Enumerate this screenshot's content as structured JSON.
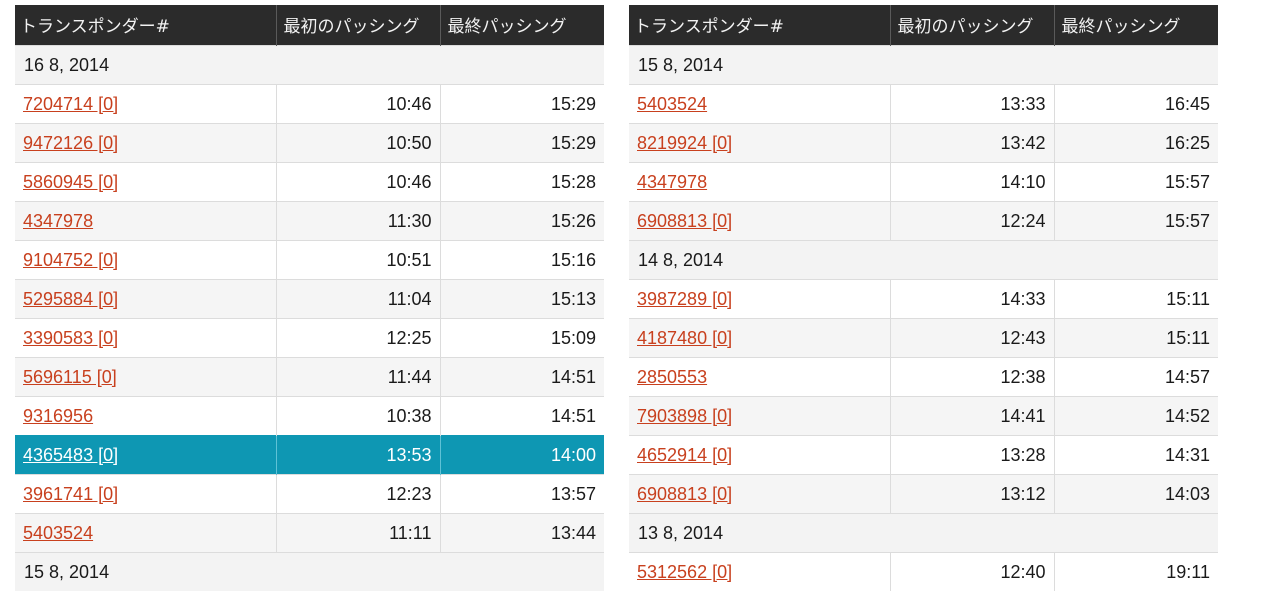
{
  "headers": {
    "transponder": "トランスポンダー#",
    "first_passing": "最初のパッシング",
    "last_passing": "最終パッシング"
  },
  "colors": {
    "header_bg": "#2b2b2b",
    "link": "#c8401e",
    "selected_bg": "#0e97b3"
  },
  "left_table": [
    {
      "type": "date",
      "label": "16 8, 2014"
    },
    {
      "type": "row",
      "id": "7204714 [0]",
      "first": "10:46",
      "last": "15:29"
    },
    {
      "type": "row",
      "id": "9472126 [0]",
      "first": "10:50",
      "last": "15:29"
    },
    {
      "type": "row",
      "id": "5860945 [0]",
      "first": "10:46",
      "last": "15:28"
    },
    {
      "type": "row",
      "id": "4347978",
      "first": "11:30",
      "last": "15:26"
    },
    {
      "type": "row",
      "id": "9104752 [0]",
      "first": "10:51",
      "last": "15:16"
    },
    {
      "type": "row",
      "id": "5295884 [0]",
      "first": "11:04",
      "last": "15:13"
    },
    {
      "type": "row",
      "id": "3390583 [0]",
      "first": "12:25",
      "last": "15:09"
    },
    {
      "type": "row",
      "id": "5696115 [0]",
      "first": "11:44",
      "last": "14:51"
    },
    {
      "type": "row",
      "id": "9316956",
      "first": "10:38",
      "last": "14:51"
    },
    {
      "type": "row",
      "id": "4365483 [0]",
      "first": "13:53",
      "last": "14:00",
      "selected": true
    },
    {
      "type": "row",
      "id": "3961741 [0]",
      "first": "12:23",
      "last": "13:57"
    },
    {
      "type": "row",
      "id": "5403524",
      "first": "11:11",
      "last": "13:44"
    },
    {
      "type": "date",
      "label": "15 8, 2014"
    }
  ],
  "right_table": [
    {
      "type": "date",
      "label": "15 8, 2014"
    },
    {
      "type": "row",
      "id": "5403524",
      "first": "13:33",
      "last": "16:45"
    },
    {
      "type": "row",
      "id": "8219924 [0]",
      "first": "13:42",
      "last": "16:25"
    },
    {
      "type": "row",
      "id": "4347978",
      "first": "14:10",
      "last": "15:57"
    },
    {
      "type": "row",
      "id": "6908813 [0]",
      "first": "12:24",
      "last": "15:57"
    },
    {
      "type": "date",
      "label": "14 8, 2014"
    },
    {
      "type": "row",
      "id": "3987289 [0]",
      "first": "14:33",
      "last": "15:11"
    },
    {
      "type": "row",
      "id": "4187480 [0]",
      "first": "12:43",
      "last": "15:11"
    },
    {
      "type": "row",
      "id": "2850553",
      "first": "12:38",
      "last": "14:57"
    },
    {
      "type": "row",
      "id": "7903898 [0]",
      "first": "14:41",
      "last": "14:52"
    },
    {
      "type": "row",
      "id": "4652914 [0]",
      "first": "13:28",
      "last": "14:31"
    },
    {
      "type": "row",
      "id": "6908813 [0]",
      "first": "13:12",
      "last": "14:03"
    },
    {
      "type": "date",
      "label": "13 8, 2014"
    },
    {
      "type": "row",
      "id": "5312562 [0]",
      "first": "12:40",
      "last": "19:11"
    }
  ]
}
